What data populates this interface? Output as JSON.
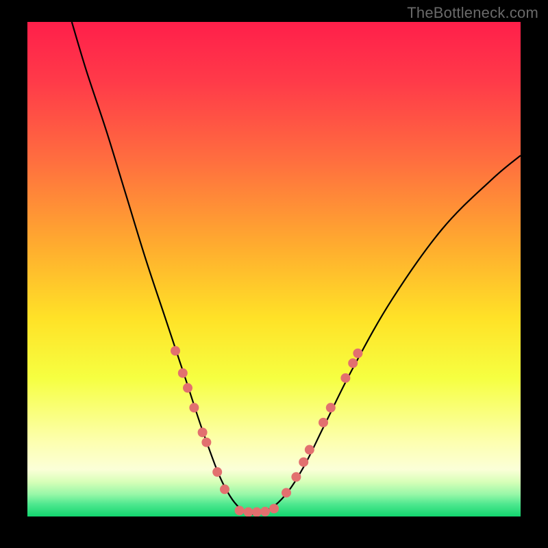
{
  "watermark": "TheBottleneck.com",
  "chart_data": {
    "type": "line",
    "title": "",
    "xlabel": "",
    "ylabel": "",
    "xlim": [
      0,
      100
    ],
    "ylim": [
      0,
      100
    ],
    "curve_description": "V-shaped bottleneck curve plunging from top-left to a minimum near x≈45 then rising to upper-right",
    "curve_points": [
      {
        "x": 9,
        "y": 100
      },
      {
        "x": 12,
        "y": 90
      },
      {
        "x": 16,
        "y": 78
      },
      {
        "x": 20,
        "y": 65
      },
      {
        "x": 24,
        "y": 52
      },
      {
        "x": 28,
        "y": 40
      },
      {
        "x": 32,
        "y": 28
      },
      {
        "x": 36,
        "y": 16
      },
      {
        "x": 40,
        "y": 6
      },
      {
        "x": 44,
        "y": 1
      },
      {
        "x": 48,
        "y": 1
      },
      {
        "x": 52,
        "y": 4
      },
      {
        "x": 56,
        "y": 10
      },
      {
        "x": 60,
        "y": 18
      },
      {
        "x": 66,
        "y": 30
      },
      {
        "x": 74,
        "y": 44
      },
      {
        "x": 84,
        "y": 58
      },
      {
        "x": 94,
        "y": 68
      },
      {
        "x": 100,
        "y": 73
      }
    ],
    "dots_left": [
      {
        "x": 30.0,
        "y": 33.5
      },
      {
        "x": 31.5,
        "y": 29.0
      },
      {
        "x": 32.5,
        "y": 26.0
      },
      {
        "x": 33.8,
        "y": 22.0
      },
      {
        "x": 35.5,
        "y": 17.0
      },
      {
        "x": 36.3,
        "y": 15.0
      },
      {
        "x": 38.5,
        "y": 9.0
      },
      {
        "x": 40.0,
        "y": 5.5
      }
    ],
    "dots_bottom": [
      {
        "x": 43.0,
        "y": 1.2
      },
      {
        "x": 44.8,
        "y": 0.9
      },
      {
        "x": 46.5,
        "y": 0.9
      },
      {
        "x": 48.2,
        "y": 1.0
      },
      {
        "x": 50.0,
        "y": 1.6
      }
    ],
    "dots_right": [
      {
        "x": 52.5,
        "y": 4.8
      },
      {
        "x": 54.5,
        "y": 8.0
      },
      {
        "x": 56.0,
        "y": 11.0
      },
      {
        "x": 57.2,
        "y": 13.5
      },
      {
        "x": 60.0,
        "y": 19.0
      },
      {
        "x": 61.5,
        "y": 22.0
      },
      {
        "x": 64.5,
        "y": 28.0
      },
      {
        "x": 66.0,
        "y": 31.0
      },
      {
        "x": 67.0,
        "y": 33.0
      }
    ],
    "gradient_stops": [
      {
        "offset": 0.0,
        "color": "#ff1f4a"
      },
      {
        "offset": 0.12,
        "color": "#ff3a49"
      },
      {
        "offset": 0.28,
        "color": "#ff6e3f"
      },
      {
        "offset": 0.45,
        "color": "#ffab2f"
      },
      {
        "offset": 0.6,
        "color": "#ffe227"
      },
      {
        "offset": 0.72,
        "color": "#f6ff41"
      },
      {
        "offset": 0.85,
        "color": "#fdffb0"
      },
      {
        "offset": 0.905,
        "color": "#fbffd8"
      },
      {
        "offset": 0.93,
        "color": "#d7ffb8"
      },
      {
        "offset": 0.955,
        "color": "#98f7a8"
      },
      {
        "offset": 0.975,
        "color": "#4fe88f"
      },
      {
        "offset": 1.0,
        "color": "#12d66f"
      }
    ],
    "dot_color": "#e2706f",
    "dot_radius_px": 7
  }
}
